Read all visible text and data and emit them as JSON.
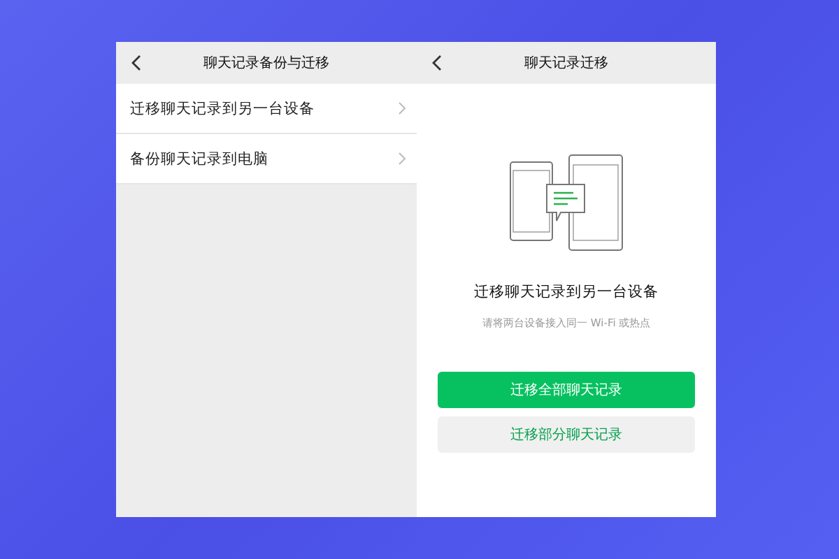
{
  "left_screen": {
    "title": "聊天记录备份与迁移",
    "items": [
      {
        "label": "迁移聊天记录到另一台设备"
      },
      {
        "label": "备份聊天记录到电脑"
      }
    ]
  },
  "right_screen": {
    "title": "聊天记录迁移",
    "heading": "迁移聊天记录到另一台设备",
    "hint": "请将两台设备接入同一 Wi-Fi 或热点",
    "buttons": [
      {
        "label": "迁移全部聊天记录",
        "kind": "primary"
      },
      {
        "label": "迁移部分聊天记录",
        "kind": "secondary"
      }
    ]
  }
}
